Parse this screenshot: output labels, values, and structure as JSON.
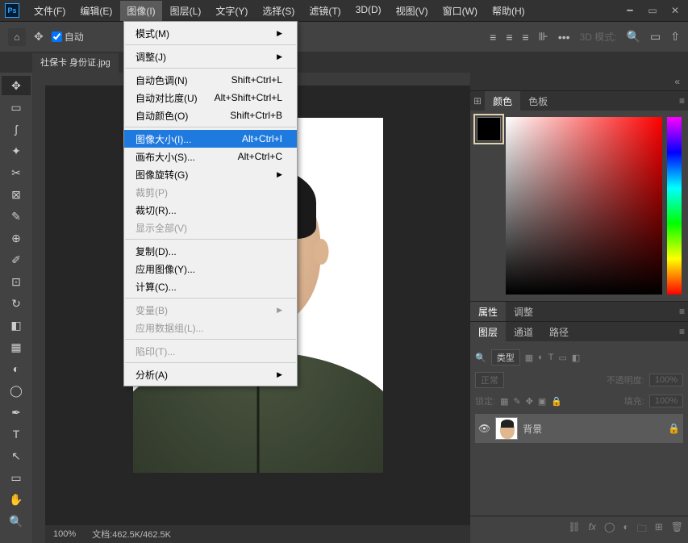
{
  "menu": {
    "file": "文件(F)",
    "edit": "编辑(E)",
    "image": "图像(I)",
    "layer": "图层(L)",
    "text": "文字(Y)",
    "select": "选择(S)",
    "filter": "滤镜(T)",
    "threed": "3D(D)",
    "view": "视图(V)",
    "window": "窗口(W)",
    "help": "帮助(H)"
  },
  "opt": {
    "auto": "自动",
    "threed_mode": "3D 模式:"
  },
  "doc_tab": "社保卡 身份证.jpg",
  "dropdown": {
    "mode": "模式(M)",
    "adjust": "调整(J)",
    "auto_tone": "自动色调(N)",
    "auto_tone_k": "Shift+Ctrl+L",
    "auto_contrast": "自动对比度(U)",
    "auto_contrast_k": "Alt+Shift+Ctrl+L",
    "auto_color": "自动颜色(O)",
    "auto_color_k": "Shift+Ctrl+B",
    "image_size": "图像大小(I)...",
    "image_size_k": "Alt+Ctrl+I",
    "canvas_size": "画布大小(S)...",
    "canvas_size_k": "Alt+Ctrl+C",
    "rotate": "图像旋转(G)",
    "crop": "裁剪(P)",
    "trim": "裁切(R)...",
    "reveal": "显示全部(V)",
    "duplicate": "复制(D)...",
    "apply_img": "应用图像(Y)...",
    "calc": "计算(C)...",
    "variable": "变量(B)",
    "apply_data": "应用数据组(L)...",
    "trap": "陷印(T)...",
    "analysis": "分析(A)"
  },
  "status": {
    "zoom": "100%",
    "doc": "文档:462.5K/462.5K"
  },
  "panels": {
    "color": "颜色",
    "swatches": "色板",
    "properties": "属性",
    "adjust": "调整",
    "layers": "图层",
    "channels": "通道",
    "paths": "路径",
    "kind": "类型",
    "normal": "正常",
    "opacity_lbl": "不透明度:",
    "opacity": "100%",
    "lock_lbl": "锁定:",
    "fill_lbl": "填充:",
    "fill": "100%",
    "layer_bg": "背景"
  }
}
